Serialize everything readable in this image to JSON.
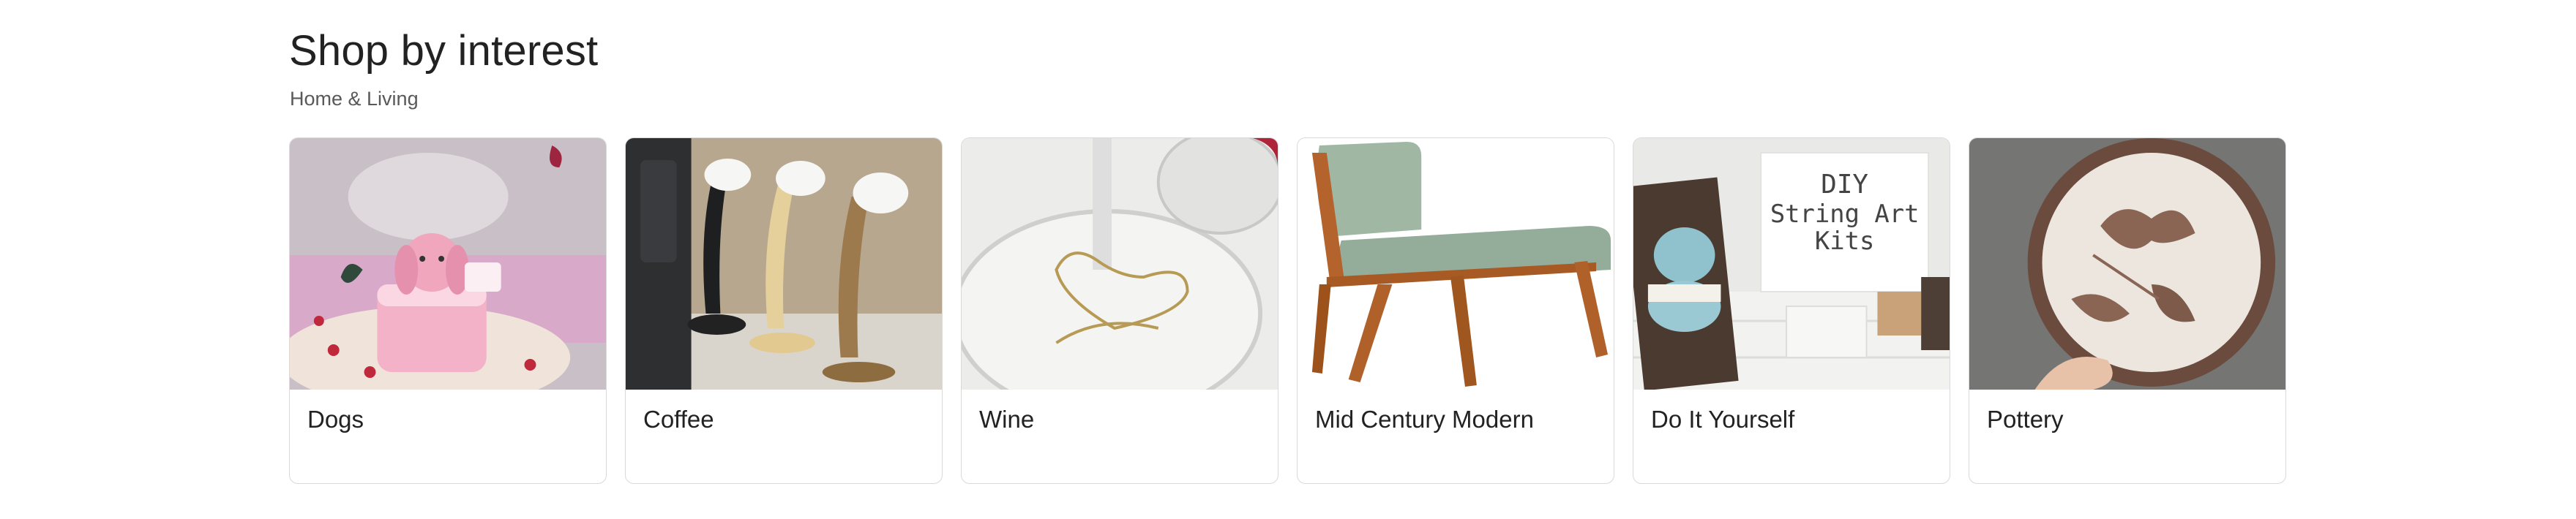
{
  "section": {
    "title": "Shop by interest",
    "subtitle": "Home & Living"
  },
  "cards": [
    {
      "label": "Dogs",
      "image": "dog-cake-photo"
    },
    {
      "label": "Coffee",
      "image": "pouring-coffee-cups-photo"
    },
    {
      "label": "Wine",
      "image": "wine-glass-charm-photo",
      "image_text": "lauren"
    },
    {
      "label": "Mid Century Modern",
      "image": "mid-century-chair-photo"
    },
    {
      "label": "Do It Yourself",
      "image": "diy-string-art-photo",
      "image_text": "DIY String Art Kits"
    },
    {
      "label": "Pottery",
      "image": "pottery-plate-photo"
    }
  ]
}
